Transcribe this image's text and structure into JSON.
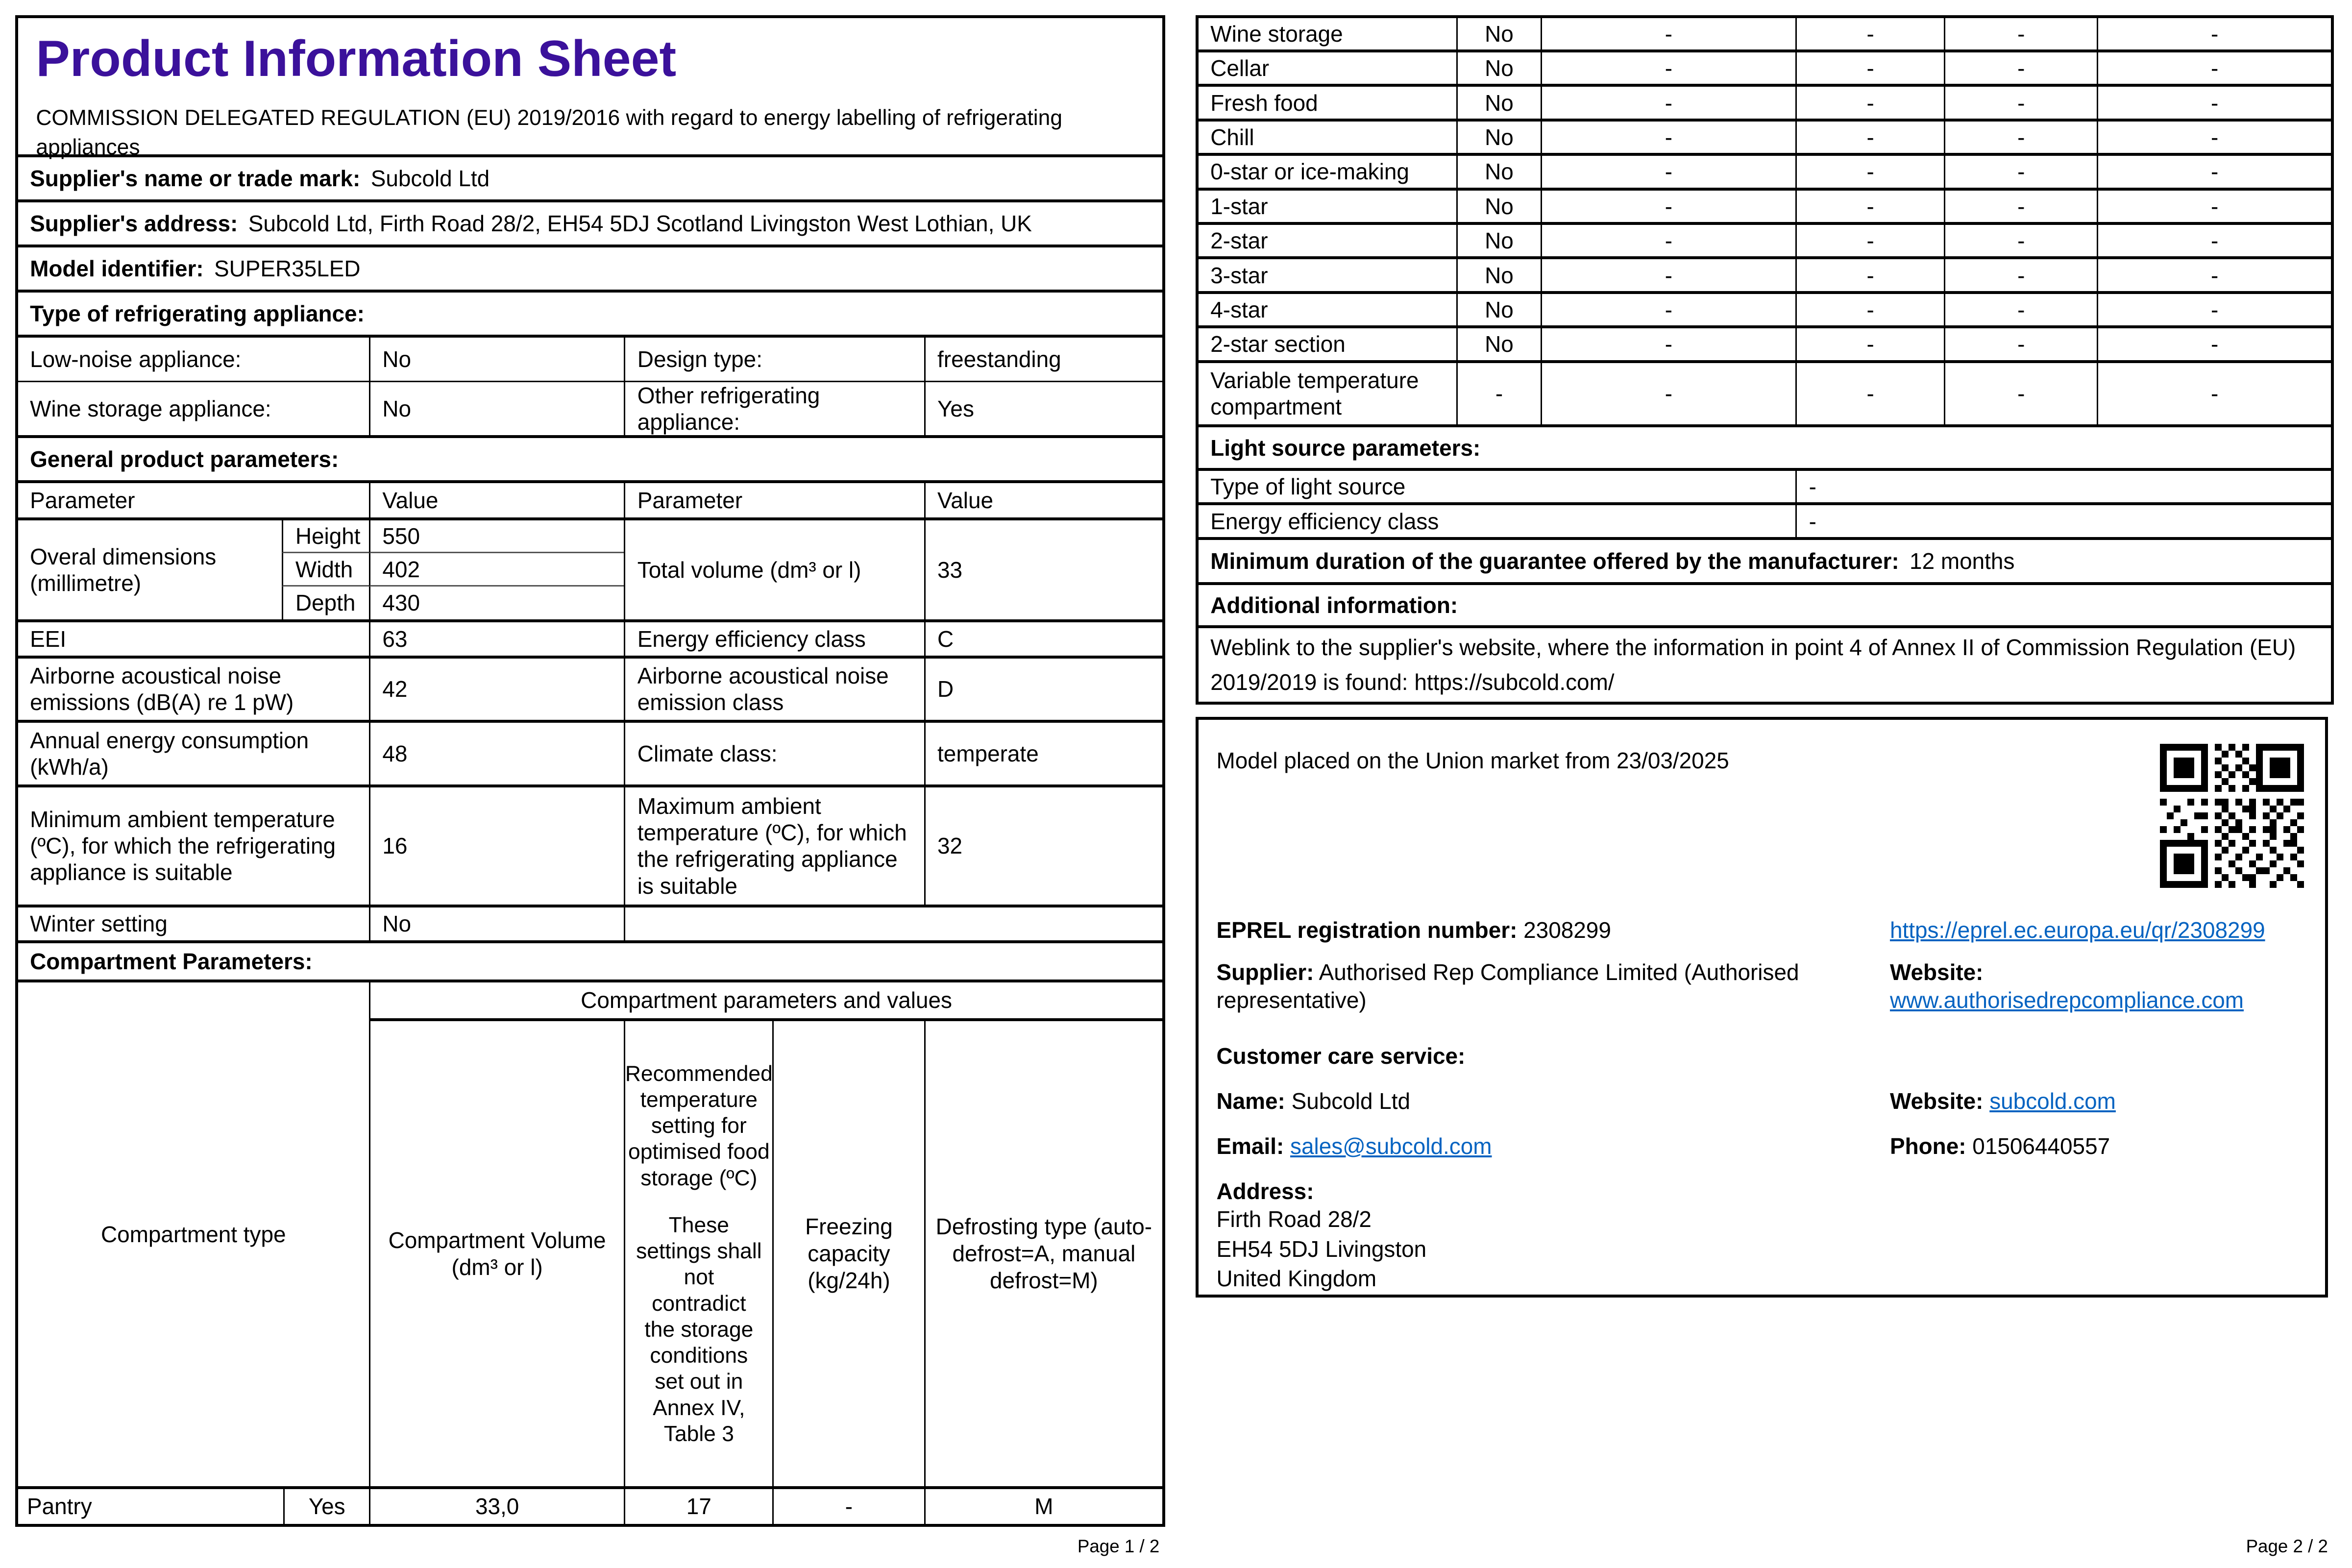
{
  "accent_color": "#3B119B",
  "link_color": "#0563C1",
  "page1": {
    "title": "Product Information Sheet",
    "regulation_text": "COMMISSION DELEGATED REGULATION (EU) 2019/2016 with regard to energy labelling of refrigerating appliances",
    "supplier_name": {
      "label": "Supplier's name or trade mark:",
      "value": "Subcold Ltd"
    },
    "supplier_address": {
      "label": "Supplier's address:",
      "value": "Subcold Ltd, Firth Road 28/2, EH54 5DJ Scotland Livingston West Lothian, UK"
    },
    "model_identifier": {
      "label": "Model identifier:",
      "value": "SUPER35LED"
    },
    "type_section_label": "Type of refrigerating appliance:",
    "type_rows": [
      {
        "p1": "Low-noise appliance:",
        "v1": "No",
        "p2": "Design type:",
        "v2": "freestanding"
      },
      {
        "p1": "Wine storage appliance:",
        "v1": "No",
        "p2": "Other refrigerating appliance:",
        "v2": "Yes"
      }
    ],
    "general_section_label": "General product parameters:",
    "param_header": {
      "p1": "Parameter",
      "v1": "Value",
      "p2": "Parameter",
      "v2": "Value"
    },
    "dimensions": {
      "label": "Overal dimensions (millimetre)",
      "rows": [
        {
          "name": "Height",
          "value": "550"
        },
        {
          "name": "Width",
          "value": "402"
        },
        {
          "name": "Depth",
          "value": "430"
        }
      ],
      "p2": "Total volume (dm³ or l)",
      "v2": "33"
    },
    "general_rows": [
      {
        "p1": "EEI",
        "v1": "63",
        "p2": "Energy efficiency class",
        "v2": "C"
      },
      {
        "p1": "Airborne acoustical noise emissions (dB(A) re 1 pW)",
        "v1": "42",
        "p2": "Airborne acoustical noise emission class",
        "v2": "D"
      },
      {
        "p1": "Annual energy consumption (kWh/a)",
        "v1": "48",
        "p2": "Climate class:",
        "v2": "temperate"
      },
      {
        "p1": "Minimum ambient temperature (ºC), for which the refrigerating appliance is suitable",
        "v1": "16",
        "p2": "Maximum ambient temperature (ºC), for which the refrigerating appliance is suitable",
        "v2": "32"
      }
    ],
    "winter_setting": {
      "label": "Winter setting",
      "value": "No"
    },
    "compartment_section_label": "Compartment Parameters:",
    "compartment_table": {
      "group_header": "Compartment parameters and values",
      "col_type": "Compartment type",
      "col_volume": "Compartment Volume (dm³ or l)",
      "col_temp_line1": "Recommended temperature setting for optimised food storage (ºC)",
      "col_temp_line2": "These settings shall not contradict the storage conditions set out in Annex IV, Table 3",
      "col_freezing": "Freezing capacity (kg/24h)",
      "col_defrost": "Defrosting type (auto-defrost=A, manual defrost=M)",
      "row": {
        "type": "Pantry",
        "present": "Yes",
        "volume": "33,0",
        "temp": "17",
        "freezing": "-",
        "defrost": "M"
      }
    },
    "footer": "Page 1 / 2"
  },
  "page2": {
    "compartment_rows": [
      {
        "name": "Wine storage",
        "present": "No",
        "values": [
          "-",
          "-",
          "-",
          "-"
        ]
      },
      {
        "name": "Cellar",
        "present": "No",
        "values": [
          "-",
          "-",
          "-",
          "-"
        ]
      },
      {
        "name": "Fresh food",
        "present": "No",
        "values": [
          "-",
          "-",
          "-",
          "-"
        ]
      },
      {
        "name": "Chill",
        "present": "No",
        "values": [
          "-",
          "-",
          "-",
          "-"
        ]
      },
      {
        "name": "0-star or ice-making",
        "present": "No",
        "values": [
          "-",
          "-",
          "-",
          "-"
        ]
      },
      {
        "name": "1-star",
        "present": "No",
        "values": [
          "-",
          "-",
          "-",
          "-"
        ]
      },
      {
        "name": "2-star",
        "present": "No",
        "values": [
          "-",
          "-",
          "-",
          "-"
        ]
      },
      {
        "name": "3-star",
        "present": "No",
        "values": [
          "-",
          "-",
          "-",
          "-"
        ]
      },
      {
        "name": "4-star",
        "present": "No",
        "values": [
          "-",
          "-",
          "-",
          "-"
        ]
      },
      {
        "name": "2-star section",
        "present": "No",
        "values": [
          "-",
          "-",
          "-",
          "-"
        ]
      },
      {
        "name": "Variable temperature compartment",
        "present": "-",
        "values": [
          "-",
          "-",
          "-",
          "-"
        ]
      }
    ],
    "light_section_label": "Light source parameters:",
    "light_rows": [
      {
        "label": "Type of light source",
        "value": "-"
      },
      {
        "label": "Energy efficiency class",
        "value": "-"
      }
    ],
    "guarantee": {
      "label": "Minimum duration of the guarantee offered by the manufacturer:",
      "value": "12 months"
    },
    "additional_info_label": "Additional information:",
    "weblink": {
      "label": "Weblink to the supplier's website, where the information in point 4 of Annex II of Commission Regulation (EU) 2019/2019 is found:",
      "value": "https://subcold.com/"
    },
    "market": {
      "model_placed": "Model placed on the Union market from 23/03/2025",
      "eprel": {
        "label": "EPREL registration number:",
        "value": "2308299",
        "link": "https://eprel.ec.europa.eu/qr/2308299"
      },
      "supplier": {
        "label": "Supplier:",
        "value": "Authorised Rep Compliance Limited (Authorised representative)"
      },
      "supplier_website": {
        "label": "Website:",
        "value": "www.authorisedrepcompliance.com"
      },
      "customer_care_label": "Customer care service:",
      "care_name": {
        "label": "Name:",
        "value": "Subcold Ltd"
      },
      "care_website": {
        "label": "Website:",
        "value": "subcold.com"
      },
      "care_email": {
        "label": "Email:",
        "value": "sales@subcold.com"
      },
      "care_phone": {
        "label": "Phone:",
        "value": "01506440557"
      },
      "address_label": "Address:",
      "address_lines": "Firth Road 28/2\n EH54 5DJ Livingston\n United Kingdom"
    },
    "footer": "Page 2 / 2"
  }
}
